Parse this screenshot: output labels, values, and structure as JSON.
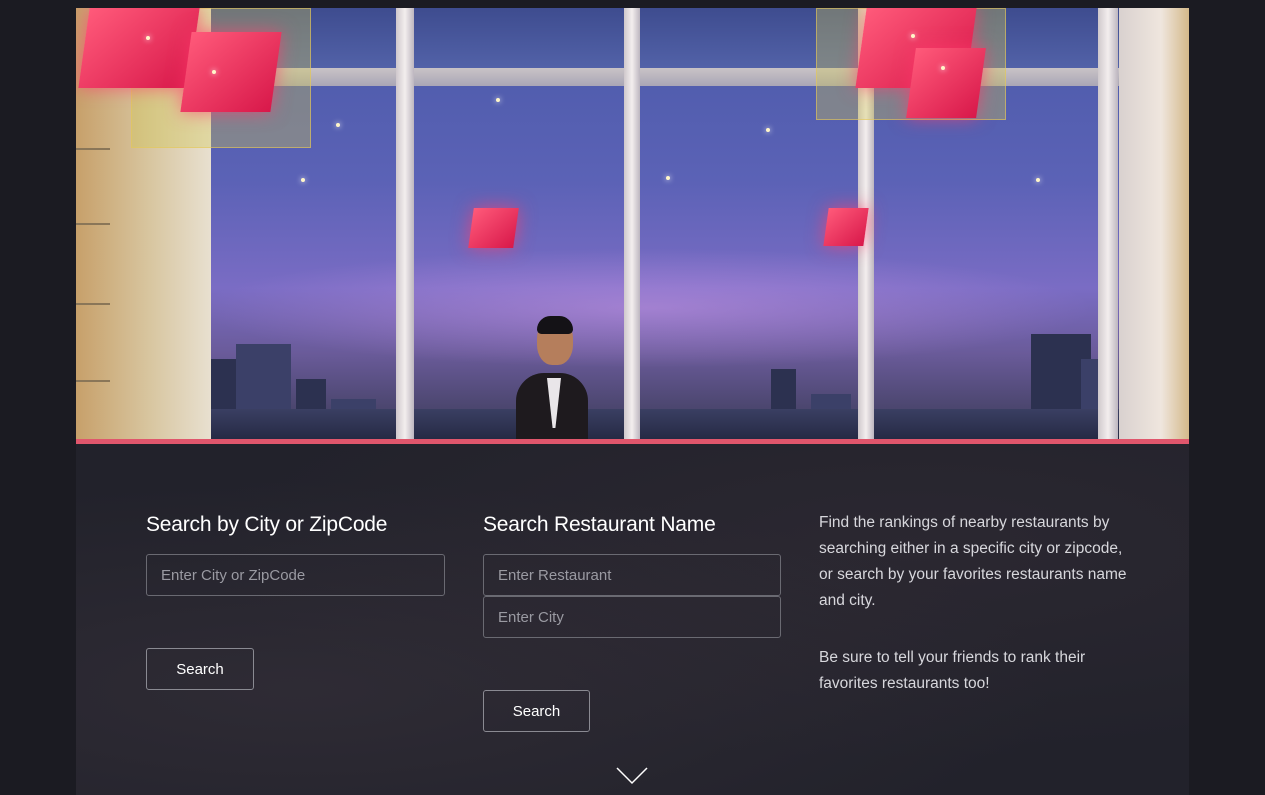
{
  "city_search": {
    "title": "Search by City or ZipCode",
    "input_placeholder": "Enter City or ZipCode",
    "button_label": "Search"
  },
  "name_search": {
    "title": "Search Restaurant Name",
    "restaurant_placeholder": "Enter Restaurant",
    "city_placeholder": "Enter City",
    "button_label": "Search"
  },
  "description": {
    "paragraph_1": "Find the rankings of nearby restaurants by searching either in a specific city or zipcode, or search by your favorites restaurants name and city.",
    "paragraph_2": "Be sure to tell your friends to rank their favorites restaurants too!"
  },
  "icons": {
    "scroll_down": "chevron-down-icon"
  },
  "colors": {
    "accent": "#e0566c",
    "background": "#1b1b22",
    "text": "#ffffff"
  }
}
